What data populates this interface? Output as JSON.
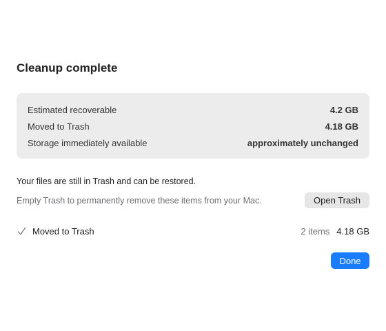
{
  "dialog": {
    "title": "Cleanup complete"
  },
  "summary": {
    "rows": [
      {
        "label": "Estimated recoverable",
        "value": "4.2 GB"
      },
      {
        "label": "Moved to Trash",
        "value": "4.18 GB"
      },
      {
        "label": "Storage immediately available",
        "value": "approximately unchanged"
      }
    ]
  },
  "trash_info": {
    "note": "Your files are still in Trash and can be restored.",
    "subnote": "Empty Trash to permanently remove these items from your Mac.",
    "open_trash_label": "Open Trash"
  },
  "result": {
    "icon": "checkmark-icon",
    "label": "Moved to Trash",
    "count": "2 items",
    "size": "4.18 GB"
  },
  "actions": {
    "done_label": "Done"
  },
  "colors": {
    "accent": "#1a7dff",
    "panel": "#ececec",
    "secondary_text": "#6e6e73"
  }
}
